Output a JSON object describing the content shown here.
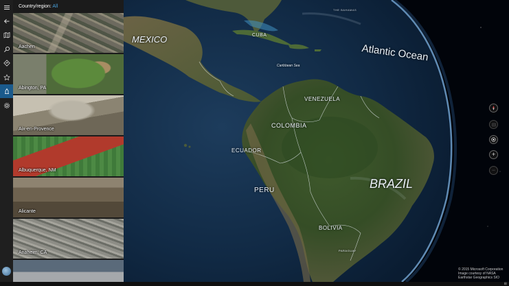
{
  "header": {
    "label": "Country/region:",
    "selected": "All"
  },
  "rail": {
    "items": [
      "menu",
      "back",
      "map",
      "search",
      "directions",
      "favorites",
      "3d-cities",
      "settings"
    ]
  },
  "cities": [
    {
      "name": "Aachen"
    },
    {
      "name": "Abington, PA"
    },
    {
      "name": "Aix-en-Provence"
    },
    {
      "name": "Albuquerque, NM"
    },
    {
      "name": "Alicante"
    },
    {
      "name": "Anaheim, CA"
    },
    {
      "name": ""
    }
  ],
  "map_labels": {
    "mexico": "MEXICO",
    "cuba": "CUBA",
    "atlantic": "Atlantic Ocean",
    "caribbean": "Caribbean Sea",
    "venezuela": "VENEZUELA",
    "colombia": "COLOMBIA",
    "ecuador": "ECUADOR",
    "peru": "PERU",
    "brazil": "BRAZIL",
    "bolivia": "BOLIVIA",
    "paraguay": "PARAGUAY",
    "bahamas": "THE BAHAMAS"
  },
  "controls": {
    "compass": "compass-icon",
    "tilt": "tilt-icon",
    "location": "location-icon",
    "zoom_in": "+",
    "zoom_out": "−"
  },
  "copyright": {
    "line1": "© 2015 Microsoft Corporation",
    "line2": "Image courtesy of NASA",
    "line3": "Earthstar Geographics SIO"
  },
  "taskbar": {
    "right": "⊞"
  },
  "colors": {
    "accent": "#1a5a8c",
    "selected_text": "#4aa3df"
  }
}
